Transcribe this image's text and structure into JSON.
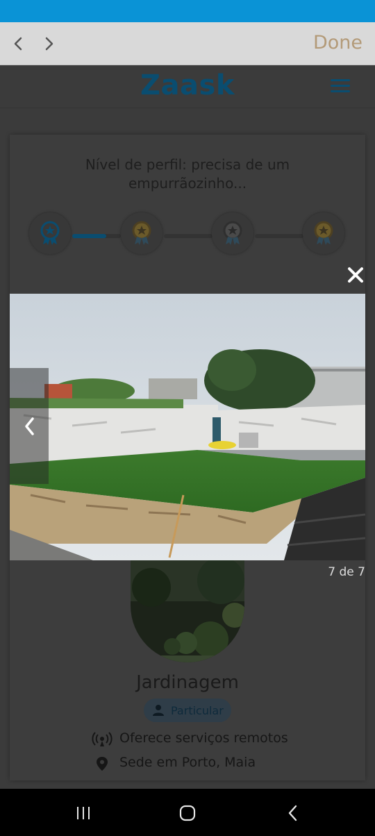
{
  "browser": {
    "done_label": "Done",
    "back_icon": "chevron-left-icon",
    "forward_icon": "chevron-right-icon"
  },
  "site": {
    "logo": "Zaask",
    "menu_icon": "hamburger-menu-icon",
    "brand_color": "#0a4d70"
  },
  "profile": {
    "level_title": "Nível de perfil: precisa de um empurrãozinho...",
    "level_progress": 0.7,
    "name": "Jardinagem",
    "type_badge": "Particular",
    "remote_services": "Oferece serviços remotos",
    "location": "Sede em Porto, Maia"
  },
  "lightbox": {
    "counter": "7 de 7",
    "close_icon": "close-icon",
    "prev_icon": "chevron-left-icon"
  },
  "system_nav": {
    "recents_icon": "recent-apps-icon",
    "home_icon": "home-icon",
    "back_icon": "back-icon"
  }
}
